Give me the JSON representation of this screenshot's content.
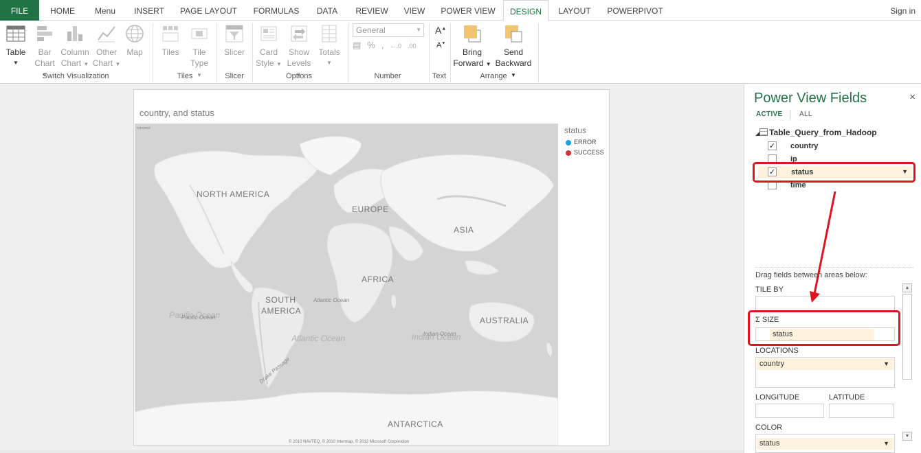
{
  "ribbon_tabs": [
    "FILE",
    "HOME",
    "Menu",
    "INSERT",
    "PAGE LAYOUT",
    "FORMULAS",
    "DATA",
    "REVIEW",
    "VIEW",
    "POWER VIEW",
    "DESIGN",
    "LAYOUT",
    "POWERPIVOT"
  ],
  "active_tab": "DESIGN",
  "sign_in": "Sign in",
  "ribbon": {
    "table": "Table",
    "bar_chart": [
      "Bar",
      "Chart"
    ],
    "column_chart": [
      "Column",
      "Chart"
    ],
    "other_chart": [
      "Other",
      "Chart"
    ],
    "map": "Map",
    "group_switch": "Switch Visualization",
    "tiles": "Tiles",
    "tile_type": [
      "Tile",
      "Type"
    ],
    "group_tiles": "Tiles",
    "slicer": "Slicer",
    "group_slicer": "Slicer",
    "card_style": [
      "Card",
      "Style"
    ],
    "show_levels": [
      "Show",
      "Levels"
    ],
    "totals": "Totals",
    "group_options": "Options",
    "number_format": "General",
    "group_number": "Number",
    "group_text": "Text",
    "bring_forward": [
      "Bring",
      "Forward"
    ],
    "send_backward": [
      "Send",
      "Backward"
    ],
    "group_arrange": "Arrange"
  },
  "viz": {
    "title": "country, and status",
    "legend_title": "status",
    "legend": [
      {
        "label": "ERROR",
        "color": "#1ba1e2"
      },
      {
        "label": "SUCCESS",
        "color": "#d13438"
      }
    ],
    "map_labels": {
      "north_america": "NORTH AMERICA",
      "europe": "EUROPE",
      "asia": "ASIA",
      "africa": "AFRICA",
      "south_america_1": "SOUTH",
      "south_america_2": "AMERICA",
      "australia": "AUSTRALIA",
      "antarctica": "ANTARCTICA",
      "pacific_ocean": "Pacific Ocean",
      "pacific_ocean_big": "Pacific Ocean",
      "atlantic_ocean": "Atlantic Ocean",
      "atlantic_ocean_big": "Atlantic Ocean",
      "indian_ocean": "Indian Ocean",
      "indian_ocean_big": "Indian Ocean",
      "drake_passage": "Drake Passage"
    },
    "attribution": "© 2010 NAVTEQ, © 2010 Intermap, © 2012 Microsoft Corporation"
  },
  "fields_pane": {
    "title": "Power View Fields",
    "close": "×",
    "tab_active": "ACTIVE",
    "tab_all": "ALL",
    "table_name": "Table_Query_from_Hadoop",
    "fields": [
      {
        "name": "country",
        "checked": true
      },
      {
        "name": "ip",
        "checked": false
      },
      {
        "name": "status",
        "checked": true
      },
      {
        "name": "time",
        "checked": false
      }
    ],
    "drag_hint": "Drag fields between areas below:",
    "tile_by": "TILE BY",
    "size": "SIZE",
    "size_value": "status",
    "locations": "LOCATIONS",
    "locations_value": "country",
    "longitude": "LONGITUDE",
    "latitude": "LATITUDE",
    "color": "COLOR",
    "color_value": "status"
  }
}
